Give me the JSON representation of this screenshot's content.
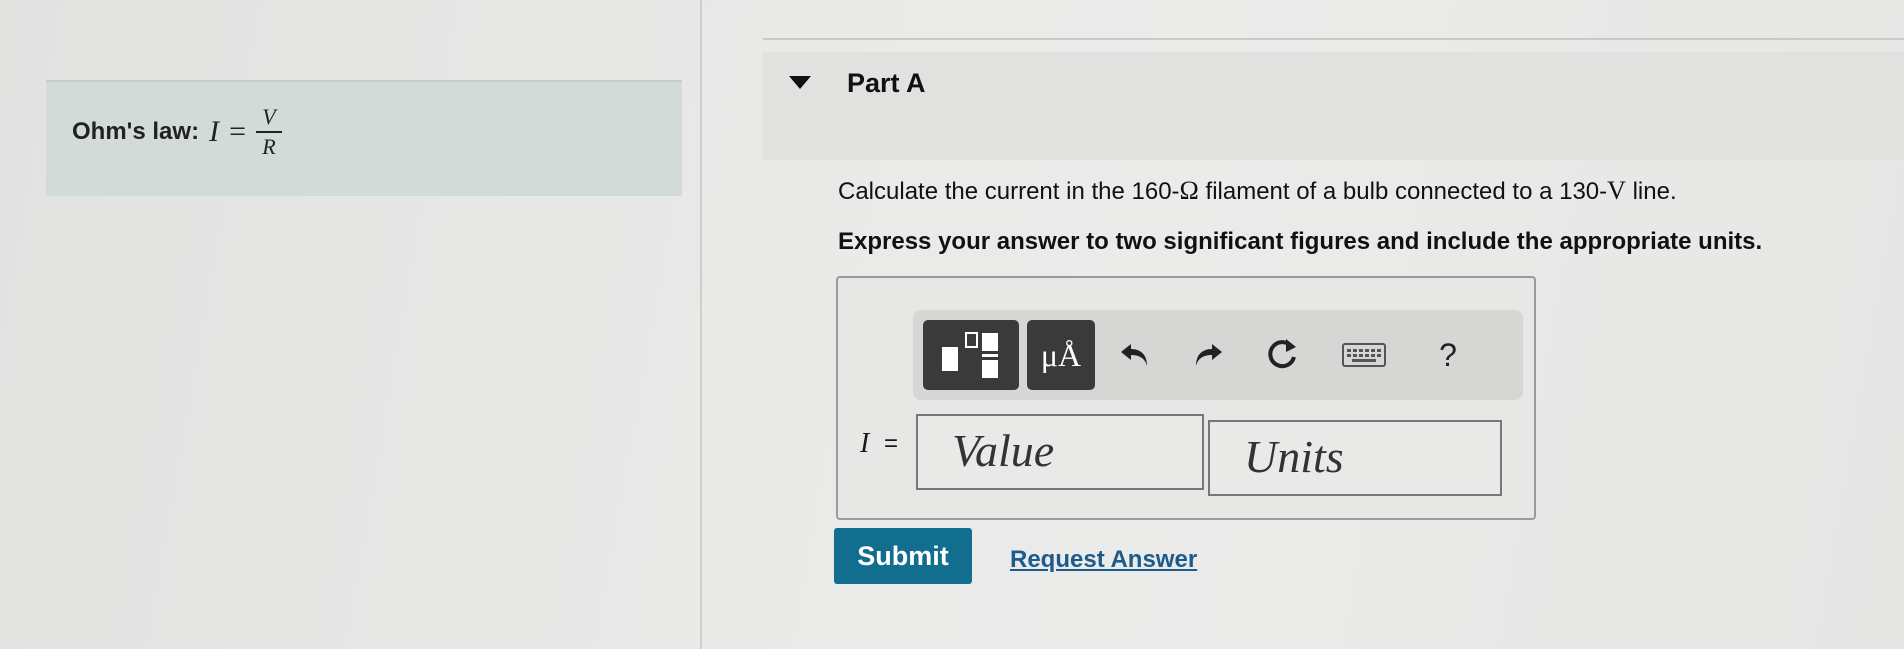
{
  "hint": {
    "label": "Ohm's law:",
    "lhs": "I",
    "equals": "=",
    "numerator": "V",
    "denominator": "R"
  },
  "part": {
    "title": "Part A"
  },
  "question": {
    "text_before": "Calculate the current in the 160-",
    "ohm_symbol": "Ω",
    "text_middle": " filament of a bulb connected to a 130-",
    "volt_symbol": "V",
    "text_after": " line.",
    "instruction": "Express your answer to two significant figures and include the appropriate units."
  },
  "toolbar": {
    "templates_icon": "templates-icon",
    "units_label": "μÅ",
    "undo_icon": "undo-icon",
    "redo_icon": "redo-icon",
    "reset_icon": "reset-icon",
    "keyboard_icon": "keyboard-icon",
    "help_label": "?"
  },
  "answer": {
    "variable": "I",
    "equals": "=",
    "value_placeholder": "Value",
    "units_placeholder": "Units"
  },
  "actions": {
    "submit_label": "Submit",
    "request_answer_label": "Request Answer"
  },
  "colors": {
    "submit_bg": "#126e8e",
    "link": "#1d5b8c",
    "hint_bg": "#d3dbd9"
  }
}
